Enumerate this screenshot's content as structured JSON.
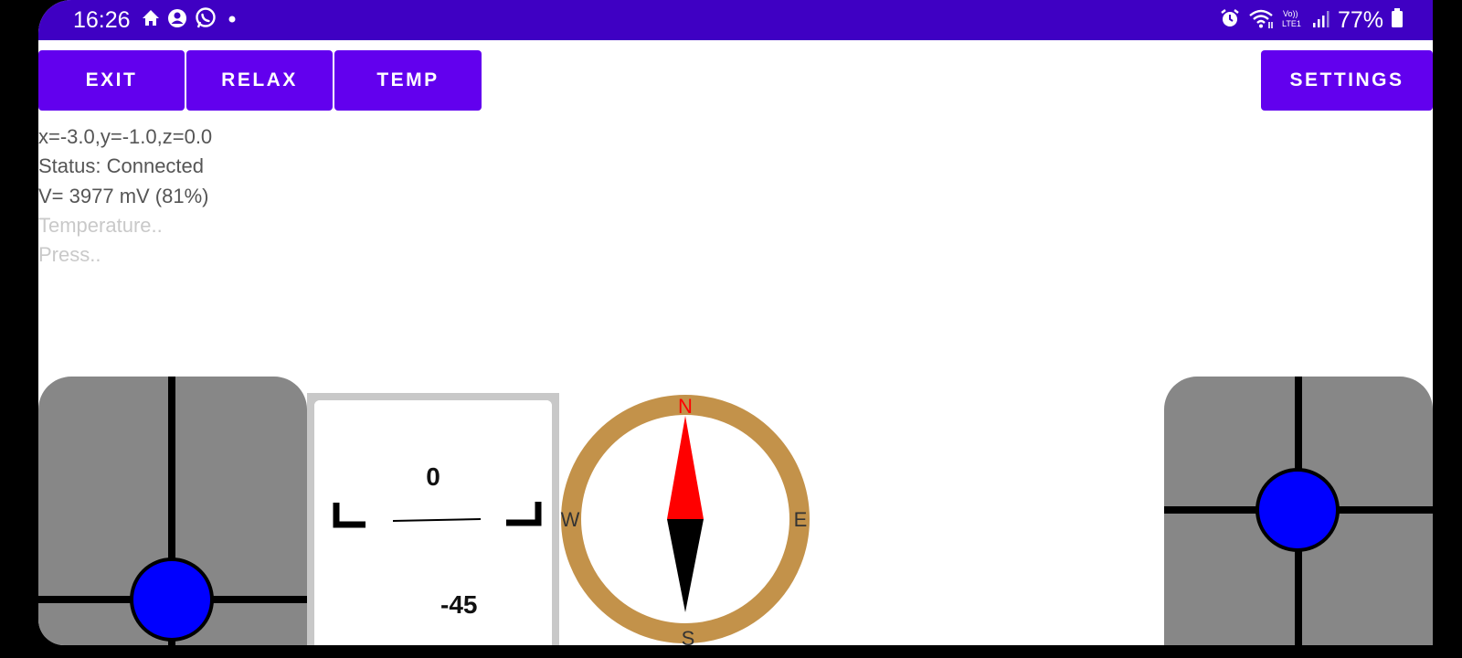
{
  "status_bar": {
    "time": "16:26",
    "battery": "77%",
    "left_icons": [
      "home-icon",
      "account-icon",
      "whatsapp-icon",
      "dot-icon"
    ],
    "right_icons": [
      "alarm-icon",
      "wifi-icon",
      "volte-icon",
      "signal-icon",
      "battery-icon"
    ],
    "volte_label": "Vo))",
    "lte_label": "LTE1"
  },
  "toolbar": {
    "exit_label": "EXIT",
    "relax_label": "RELAX",
    "temp_label": "TEMP",
    "settings_label": "SETTINGS"
  },
  "info": {
    "accel": "x=-3.0,y=-1.0,z=0.0",
    "status": "Status: Connected",
    "voltage": "V= 3977 mV (81%)",
    "temperature": "Temperature..",
    "pressure": "Press.."
  },
  "attitude": {
    "top_value": "0",
    "bottom_value": "-45"
  },
  "compass": {
    "north": "N",
    "south": "S",
    "east": "E",
    "west": "W",
    "ring_color": "#c3924a",
    "north_color": "#ff0000"
  },
  "colors": {
    "status_bar": "#3f00c3",
    "button": "#6200ee",
    "joystick_knob": "#0000ff",
    "joystick_pad": "#878787"
  }
}
